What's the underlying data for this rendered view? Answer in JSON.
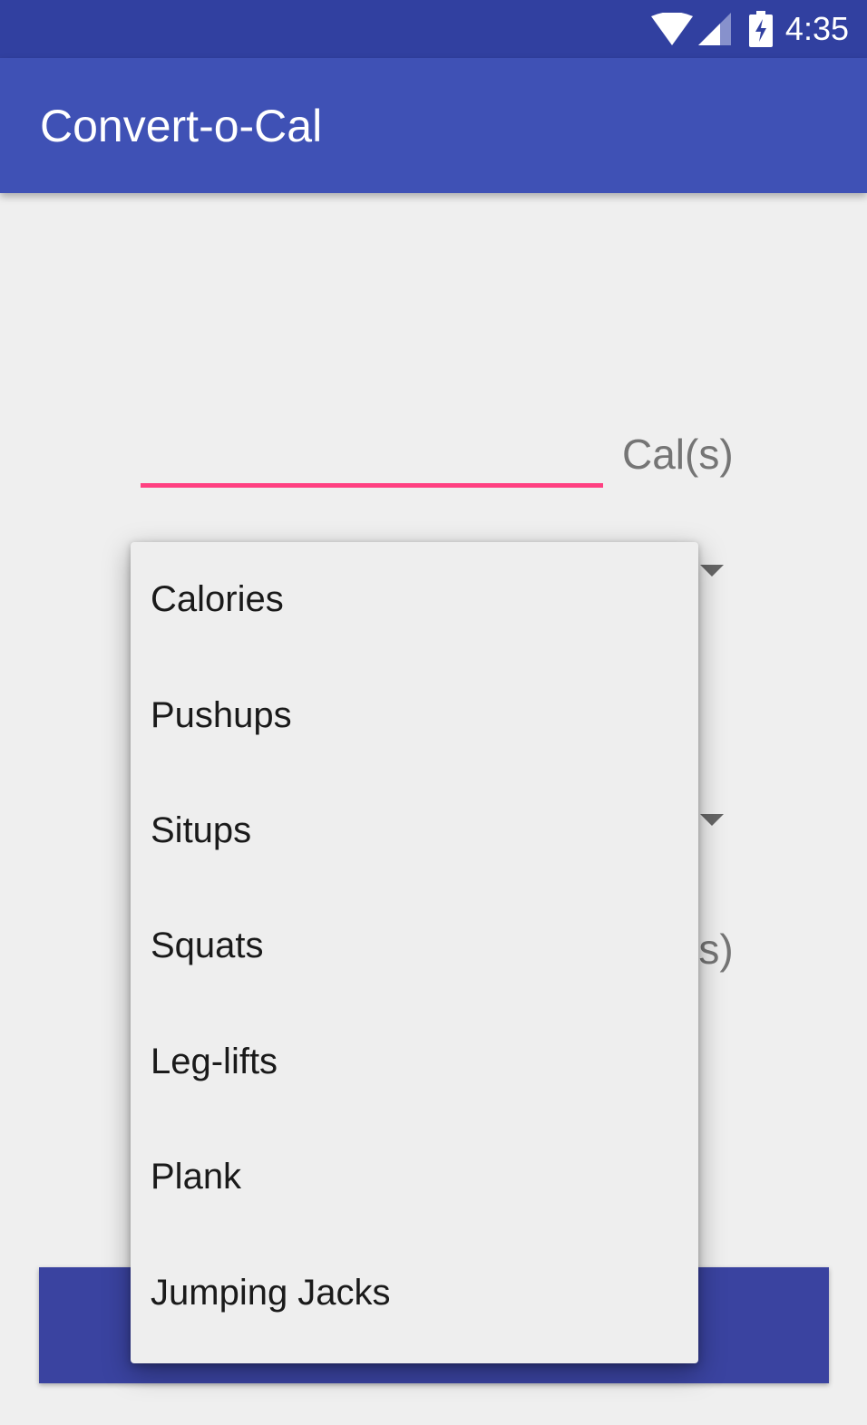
{
  "status_bar": {
    "time": "4:35",
    "icons": [
      "wifi-icon",
      "cell-signal-icon",
      "battery-charging-icon"
    ]
  },
  "app_bar": {
    "title": "Convert-o-Cal"
  },
  "form": {
    "amount_value": "",
    "unit_label_top": "Cal(s)",
    "unit_label_bottom": "Cal(s)"
  },
  "dropdown": {
    "items": [
      "Calories",
      "Pushups",
      "Situps",
      "Squats",
      "Leg-lifts",
      "Plank",
      "Jumping Jacks"
    ]
  },
  "colors": {
    "status_bar": "#3140a0",
    "app_bar": "#3f51b5",
    "accent": "#ff4081",
    "button": "#3a43a0"
  }
}
